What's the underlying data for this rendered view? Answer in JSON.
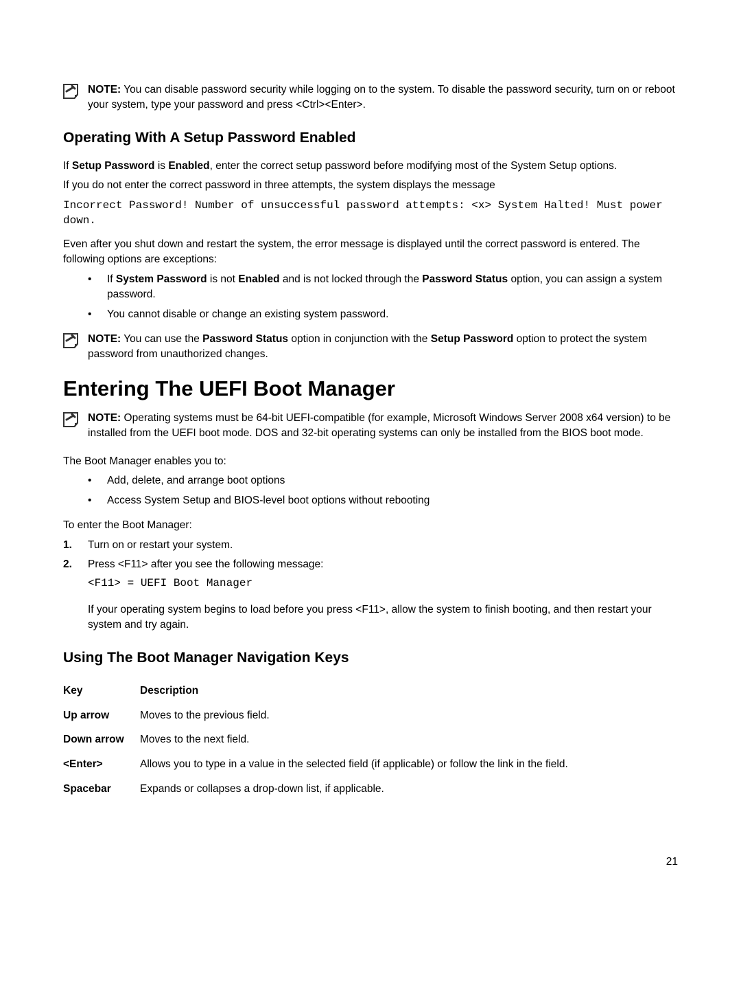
{
  "notes": {
    "note1_prefix": "NOTE:",
    "note1_text": " You can disable password security while logging on to the system. To disable the password security, turn on or reboot your system, type your password and press <Ctrl><Enter>.",
    "note2_prefix": "NOTE:",
    "note2_a": " You can use the ",
    "note2_b": "Password Status",
    "note2_c": " option in conjunction with the ",
    "note2_d": "Setup Password",
    "note2_e": " option to protect the system password from unauthorized changes.",
    "note3_prefix": "NOTE:",
    "note3_text": " Operating systems must be 64-bit UEFI-compatible (for example, Microsoft Windows Server 2008 x64 version) to be installed from the UEFI boot mode. DOS and 32-bit operating systems can only be installed from the BIOS boot mode."
  },
  "headings": {
    "h3a": "Operating With A Setup Password Enabled",
    "h2": "Entering The UEFI Boot Manager",
    "h3b": "Using The Boot Manager Navigation Keys"
  },
  "paras": {
    "p1a": "If ",
    "p1b": "Setup Password",
    "p1c": " is ",
    "p1d": "Enabled",
    "p1e": ", enter the correct setup password before modifying most of the System Setup options.",
    "p2": "If you do not enter the correct password in three attempts, the system displays the message",
    "code1": "Incorrect Password! Number of unsuccessful password attempts: <x> System Halted! Must power down.",
    "p3": "Even after you shut down and restart the system, the error message is displayed until the correct password is entered. The following options are exceptions:",
    "p4": "The Boot Manager enables you to:",
    "p5": "To enter the Boot Manager:"
  },
  "bullets": {
    "b1a": "If ",
    "b1b": "System Password",
    "b1c": " is not ",
    "b1d": "Enabled",
    "b1e": " and is not locked through the ",
    "b1f": "Password Status",
    "b1g": " option, you can assign a system password.",
    "b2": "You cannot disable or change an existing system password.",
    "b3": "Add, delete, and arrange boot options",
    "b4": "Access System Setup and BIOS-level boot options without rebooting"
  },
  "steps": {
    "n1": "1.",
    "s1": "Turn on or restart your system.",
    "n2": "2.",
    "s2": "Press <F11> after you see the following message:",
    "s2code": "<F11> = UEFI Boot Manager",
    "s2para": "If your operating system begins to load before you press <F11>, allow the system to finish booting, and then restart your system and try again."
  },
  "table": {
    "hkey": "Key",
    "hdesc": "Description",
    "rows": [
      {
        "key": "Up arrow",
        "desc": "Moves to the previous field."
      },
      {
        "key": "Down arrow",
        "desc": "Moves to the next field."
      },
      {
        "key": "<Enter>",
        "desc": "Allows you to type in a value in the selected field (if applicable) or follow the link in the field."
      },
      {
        "key": "Spacebar",
        "desc": "Expands or collapses a drop-down list, if applicable."
      }
    ]
  },
  "pagenum": "21"
}
